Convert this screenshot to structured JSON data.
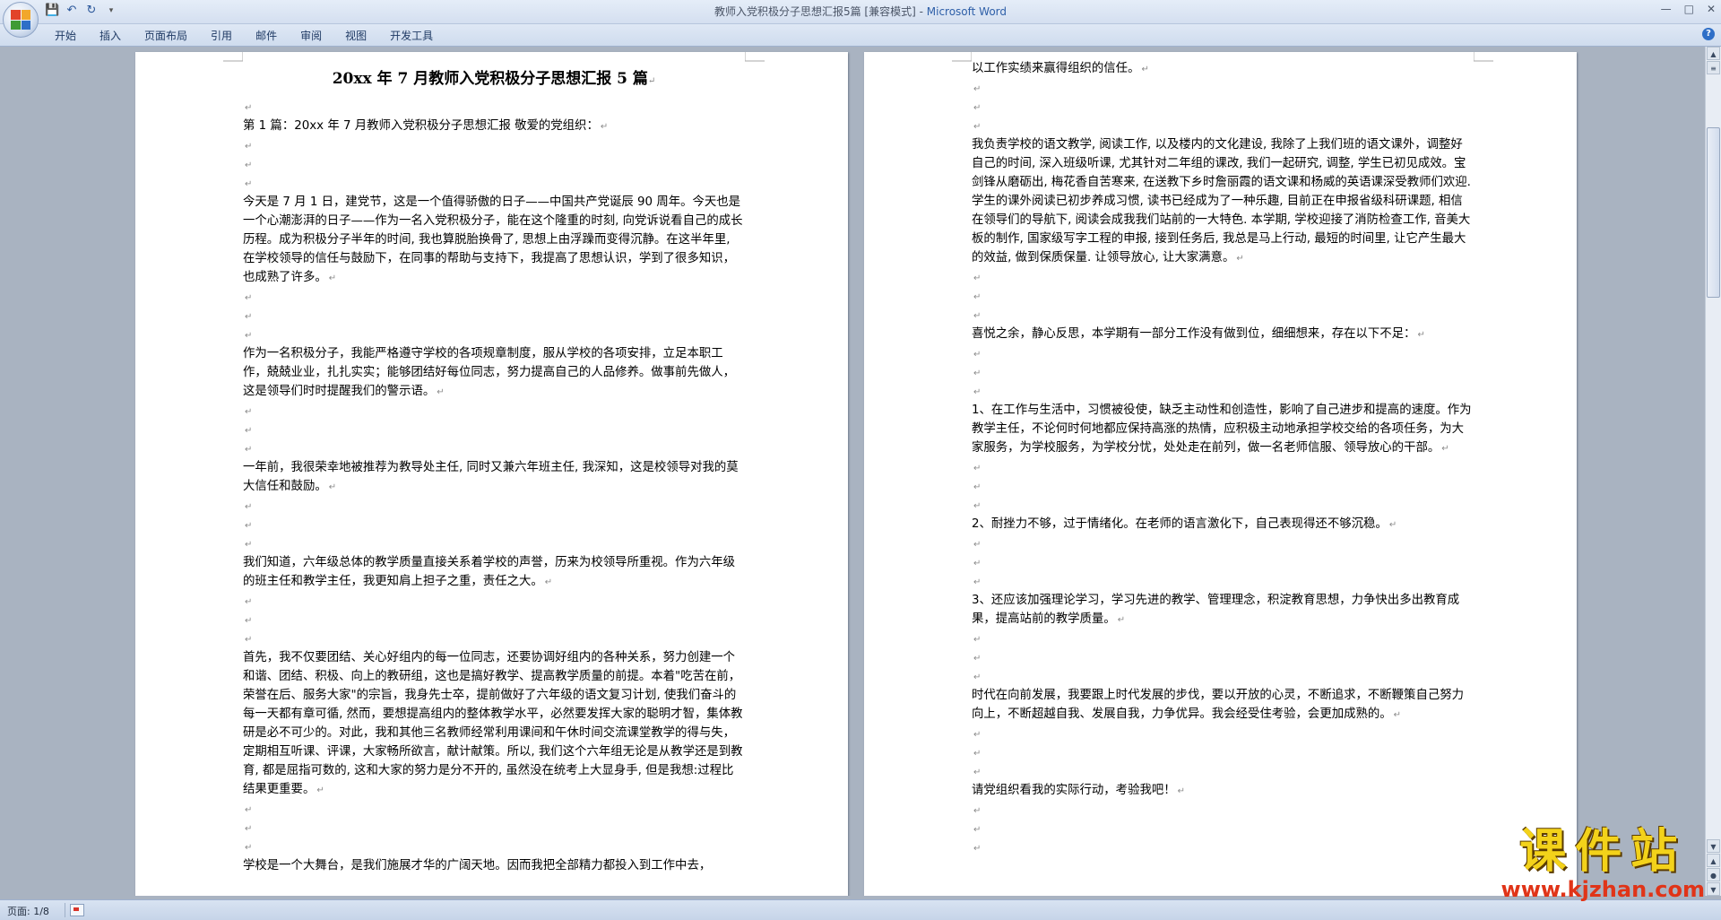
{
  "window": {
    "title": "教师入党积极分子思想汇报5篇 [兼容模式] - ",
    "app_name": "Microsoft Word"
  },
  "qat": {
    "save_icon": "save-icon",
    "undo_icon": "undo-icon",
    "redo_icon": "redo-icon"
  },
  "ribbon": {
    "tabs": [
      "开始",
      "插入",
      "页面布局",
      "引用",
      "邮件",
      "审阅",
      "视图",
      "开发工具"
    ]
  },
  "left_page": {
    "title": "20xx 年 7 月教师入党积极分子思想汇报 5 篇",
    "blocks": [
      {
        "t": ""
      },
      {
        "t": "第 1 篇：20xx 年 7 月教师入党积极分子思想汇报 敬爱的党组织："
      },
      {
        "t": ""
      },
      {
        "t": ""
      },
      {
        "t": ""
      },
      {
        "t": "今天是 7 月 1 日，建党节，这是一个值得骄傲的日子——中国共产党诞辰 90 周年。今天也是一个心潮澎湃的日子——作为一名入党积极分子，能在这个隆重的时刻, 向党诉说看自己的成长历程。成为积极分子半年的时间, 我也算脱胎换骨了, 思想上由浮躁而变得沉静。在这半年里, 在学校领导的信任与鼓励下，在同事的帮助与支持下，我提高了思想认识，学到了很多知识，也成熟了许多。"
      },
      {
        "t": ""
      },
      {
        "t": ""
      },
      {
        "t": ""
      },
      {
        "t": "作为一名积极分子，我能严格遵守学校的各项规章制度，服从学校的各项安排，立足本职工作，兢兢业业，扎扎实实；能够团结好每位同志，努力提高自己的人品修养。做事前先做人，这是领导们时时提醒我们的警示语。"
      },
      {
        "t": ""
      },
      {
        "t": ""
      },
      {
        "t": ""
      },
      {
        "t": "一年前，我很荣幸地被推荐为教导处主任, 同时又兼六年班主任, 我深知，这是校领导对我的莫大信任和鼓励。"
      },
      {
        "t": ""
      },
      {
        "t": ""
      },
      {
        "t": ""
      },
      {
        "t": "我们知道，六年级总体的教学质量直接关系着学校的声誉，历来为校领导所重视。作为六年级的班主任和教学主任，我更知肩上担子之重，责任之大。"
      },
      {
        "t": ""
      },
      {
        "t": ""
      },
      {
        "t": ""
      },
      {
        "t": "首先，我不仅要团结、关心好组内的每一位同志，还要协调好组内的各种关系，努力创建一个和谐、团结、积极、向上的教研组，这也是搞好教学、提高教学质量的前提。本着\"吃苦在前，荣誉在后、服务大家\"的宗旨，我身先士卒，提前做好了六年级的语文复习计划, 使我们奋斗的每一天都有章可循, 然而，要想提高组内的整体教学水平，必然要发挥大家的聪明才智，集体教研是必不可少的。对此，我和其他三名教师经常利用课间和午休时间交流课堂教学的得与失，定期相互听课、评课，大家畅所欲言，献计献策。所以, 我们这个六年组无论是从教学还是到教育, 都是屈指可数的, 这和大家的努力是分不开的, 虽然没在统考上大显身手, 但是我想:过程比结果更重要。"
      },
      {
        "t": ""
      },
      {
        "t": ""
      },
      {
        "t": ""
      },
      {
        "t": "学校是一个大舞台，是我们施展才华的广阔天地。因而我把全部精力都投入到工作中去，",
        "noreturn": true
      }
    ]
  },
  "right_page": {
    "blocks": [
      {
        "t": "以工作实绩来赢得组织的信任。"
      },
      {
        "t": ""
      },
      {
        "t": ""
      },
      {
        "t": ""
      },
      {
        "t": "我负责学校的语文教学, 阅读工作, 以及楼内的文化建设, 我除了上我们班的语文课外，调整好自己的时间, 深入班级听课, 尤其针对二年组的课改, 我们一起研究, 调整, 学生已初见成效。宝剑锋从磨砺出, 梅花香自苦寒来, 在送教下乡时詹丽霞的语文课和杨威的英语课深受教师们欢迎. 学生的课外阅读已初步养成习惯, 读书已经成为了一种乐趣, 目前正在申报省级科研课题, 相信在领导们的导航下, 阅读会成我我们站前的一大特色. 本学期, 学校迎接了消防检查工作, 音美大板的制作, 国家级写字工程的申报, 接到任务后, 我总是马上行动, 最短的时间里, 让它产生最大的效益, 做到保质保量. 让领导放心, 让大家满意。"
      },
      {
        "t": ""
      },
      {
        "t": ""
      },
      {
        "t": ""
      },
      {
        "t": "喜悦之余，静心反思，本学期有一部分工作没有做到位，细细想来，存在以下不足："
      },
      {
        "t": ""
      },
      {
        "t": ""
      },
      {
        "t": ""
      },
      {
        "t": "1、在工作与生活中，习惯被役使，缺乏主动性和创造性，影响了自己进步和提高的速度。作为教学主任，不论何时何地都应保持高涨的热情，应积极主动地承担学校交给的各项任务，为大家服务，为学校服务，为学校分忧，处处走在前列，做一名老师信服、领导放心的干部。"
      },
      {
        "t": ""
      },
      {
        "t": ""
      },
      {
        "t": ""
      },
      {
        "t": "2、耐挫力不够，过于情绪化。在老师的语言激化下，自己表现得还不够沉稳。"
      },
      {
        "t": ""
      },
      {
        "t": ""
      },
      {
        "t": ""
      },
      {
        "t": "3、还应该加强理论学习，学习先进的教学、管理理念，积淀教育思想，力争快出多出教育成果，提高站前的教学质量。"
      },
      {
        "t": ""
      },
      {
        "t": ""
      },
      {
        "t": ""
      },
      {
        "t": "时代在向前发展，我要跟上时代发展的步伐，要以开放的心灵，不断追求，不断鞭策自己努力向上，不断超越自我、发展自我，力争优异。我会经受住考验，会更加成熟的。"
      },
      {
        "t": ""
      },
      {
        "t": ""
      },
      {
        "t": ""
      },
      {
        "t": "请党组织看我的实际行动，考验我吧！"
      },
      {
        "t": ""
      },
      {
        "t": ""
      },
      {
        "t": ""
      }
    ]
  },
  "status": {
    "page_info": "页面: 1/8"
  },
  "watermark": {
    "main": "课件站",
    "url": "www.kjzhan.com"
  },
  "colors": {
    "office_logo": [
      "#e2432a",
      "#f2a72b",
      "#3f9b35",
      "#2f6fc7"
    ],
    "app_name_blue": "#2e5fa8",
    "watermark_yellow": "#f3d21a",
    "watermark_red": "#e03418"
  }
}
